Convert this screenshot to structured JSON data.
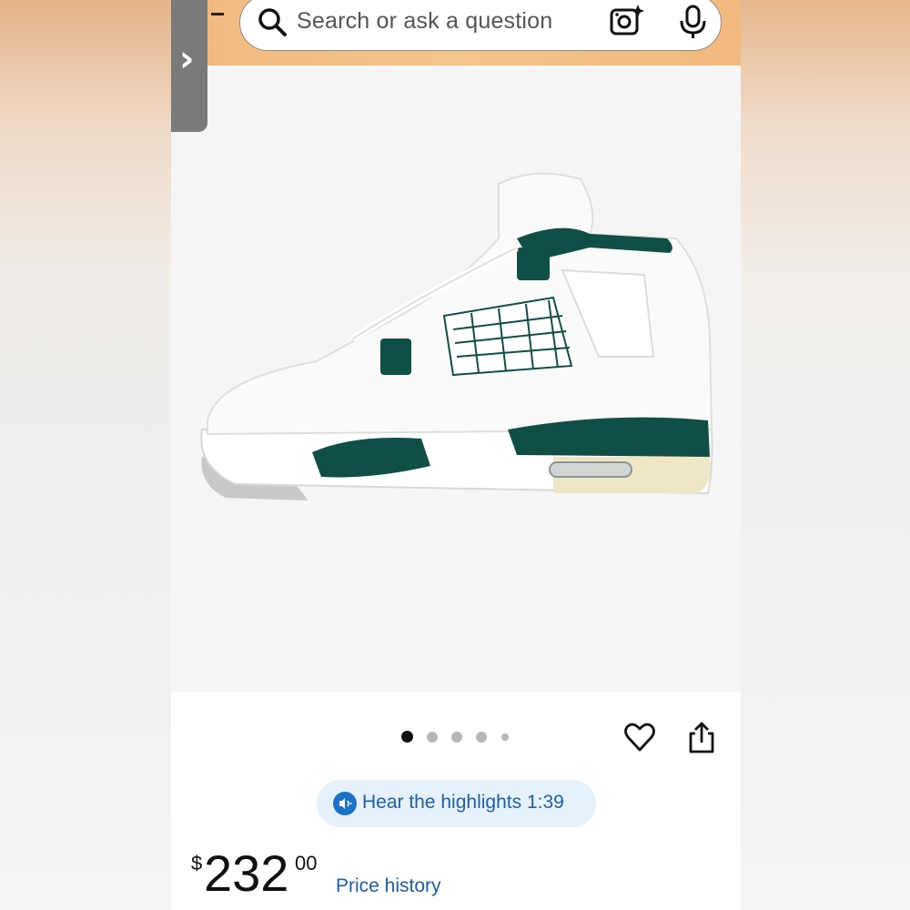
{
  "search": {
    "placeholder": "Search or ask a question",
    "icons": [
      "search-icon",
      "camera-sparkle-icon",
      "microphone-icon"
    ]
  },
  "side_tab": {
    "icon": "chevron-right-icon",
    "glyph": "›"
  },
  "product_image": {
    "description_icon": "sneaker-image",
    "colors": {
      "white": "#ffffff",
      "teal": "#0f4f45",
      "cream": "#efe6c8",
      "grey_sole": "#c9c9c9"
    }
  },
  "carousel": {
    "current_index": 1,
    "total_dots": 5
  },
  "actions": {
    "favorite_icon": "heart-icon",
    "share_icon": "share-icon"
  },
  "highlights": {
    "label": "Hear the highlights 1:39"
  },
  "price": {
    "currency": "$",
    "whole": "232",
    "cents": "00"
  },
  "price_history": {
    "label": "Price history"
  },
  "colors": {
    "header_bg": "#f2b97e",
    "link_blue": "#1b5fa8",
    "accent_blue": "#1a73c9",
    "pill_bg": "#e7f1fb"
  }
}
